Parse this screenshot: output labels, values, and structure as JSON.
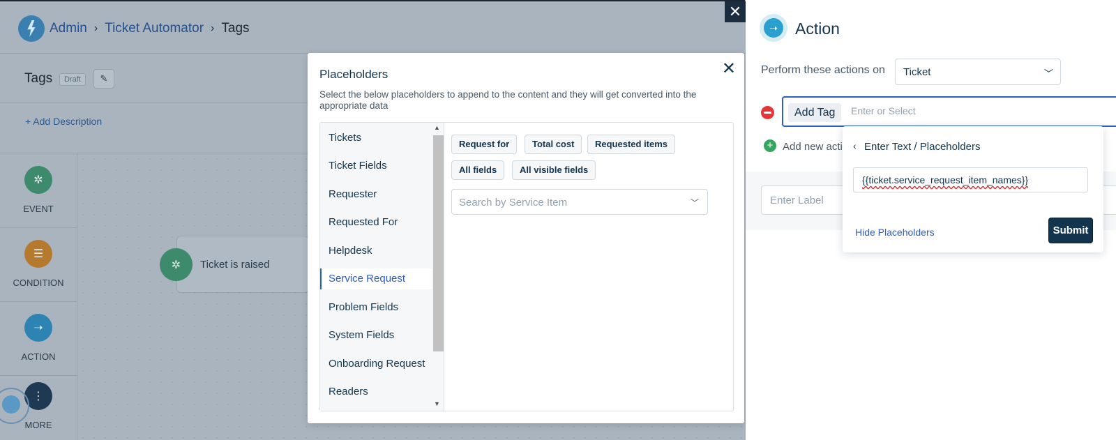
{
  "breadcrumb": {
    "admin": "Admin",
    "automator": "Ticket Automator",
    "current": "Tags",
    "sep": "›"
  },
  "page": {
    "title": "Tags",
    "draft": "Draft",
    "edit_icon": "✎",
    "add_description": "+ Add Description"
  },
  "rail": {
    "event": "EVENT",
    "condition": "CONDITION",
    "action": "ACTION",
    "more": "MORE"
  },
  "canvas": {
    "node_label": "Ticket is raised"
  },
  "modal": {
    "title": "Placeholders",
    "close": "✕",
    "description": "Select the below placeholders to append to the content and they will get converted into the appropriate data",
    "categories": [
      "Tickets",
      "Ticket Fields",
      "Requester",
      "Requested For",
      "Helpdesk",
      "Service Request",
      "Problem Fields",
      "System Fields",
      "Onboarding Request",
      "Readers"
    ],
    "active_category": "Service Request",
    "chips": [
      "Request for",
      "Total cost",
      "Requested items",
      "All fields",
      "All visible fields"
    ],
    "search_placeholder": "Search by Service Item"
  },
  "panel": {
    "close": "✕",
    "title": "Action",
    "perform_label": "Perform these actions on",
    "perform_value": "Ticket",
    "action_chip": "Add Tag",
    "action_placeholder": "Enter or Select",
    "add_action": "Add new acti",
    "label_placeholder": "Enter Label"
  },
  "popover": {
    "title": "Enter Text / Placeholders",
    "value": "{{ticket.service_request_item_names}}",
    "hide": "Hide Placeholders",
    "submit": "Submit"
  },
  "colors": {
    "accent": "#2c5cc5",
    "dark": "#12344d",
    "danger": "#e43538",
    "success": "#35a55f"
  }
}
